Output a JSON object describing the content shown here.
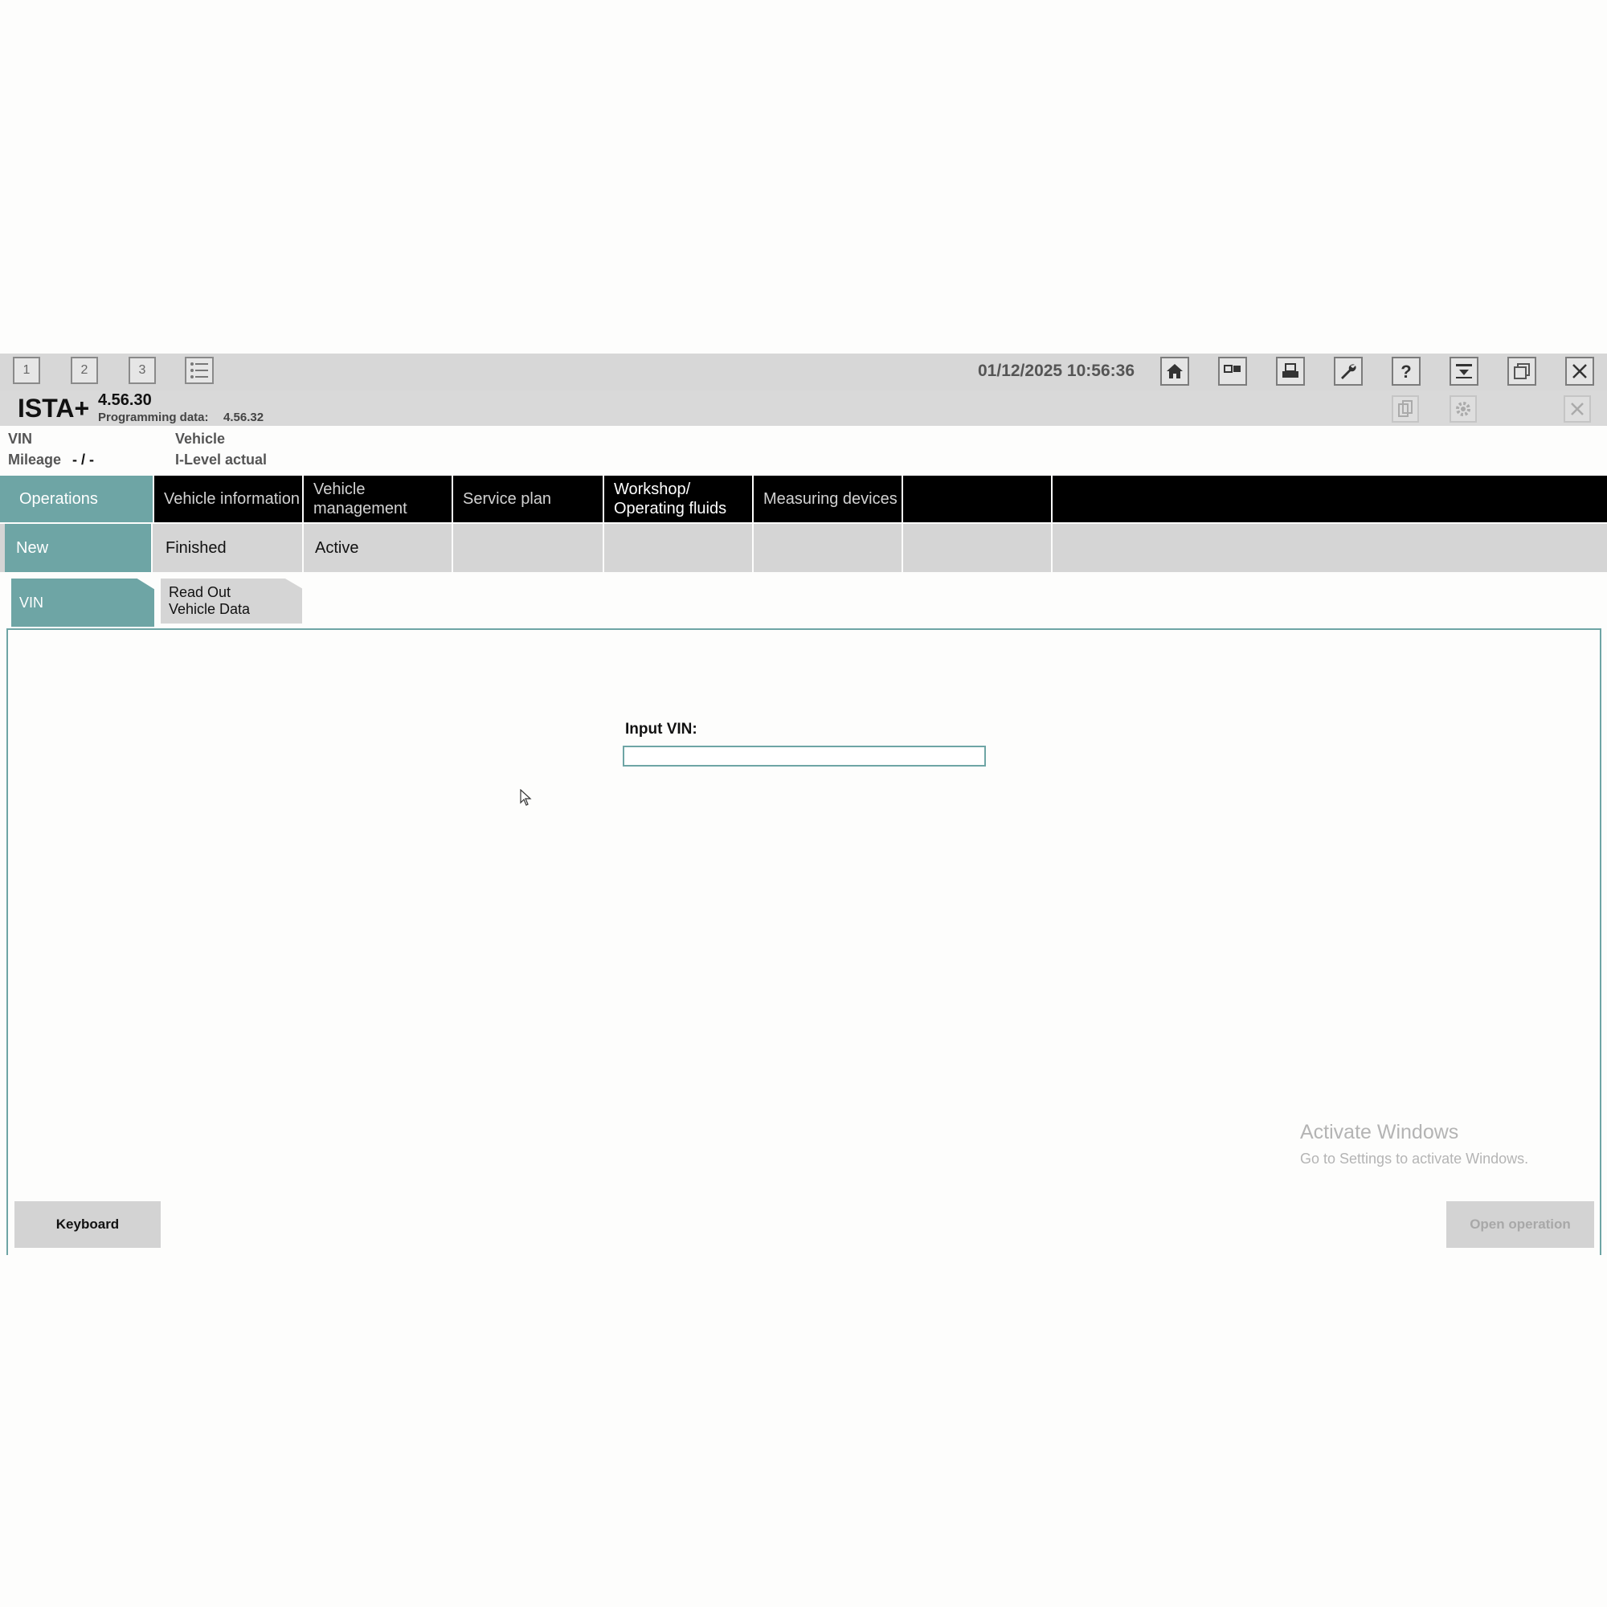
{
  "toolbar": {
    "screen_buttons": [
      "1",
      "2",
      "3"
    ],
    "datetime": "01/12/2025 10:56:36"
  },
  "header": {
    "app_name": "ISTA+",
    "version": "4.56.30",
    "programming_label": "Programming data:",
    "programming_value": "4.56.32"
  },
  "vehicle_info": {
    "vin_label": "VIN",
    "mileage_label": "Mileage",
    "mileage_value": "- / -",
    "vehicle_label": "Vehicle",
    "ilevel_label": "I-Level actual"
  },
  "main_nav": [
    {
      "label": "Operations"
    },
    {
      "label": "Vehicle information"
    },
    {
      "label": "Vehicle management"
    },
    {
      "label": "Service plan"
    },
    {
      "label": "Workshop/ Operating fluids"
    },
    {
      "label": "Measuring devices"
    }
  ],
  "sub_nav": [
    {
      "label": "New"
    },
    {
      "label": "Finished"
    },
    {
      "label": "Active"
    }
  ],
  "tertiary_tabs": [
    {
      "label": "VIN"
    },
    {
      "label": "Read Out Vehicle Data"
    }
  ],
  "form": {
    "vin_label": "Input VIN:",
    "vin_value": ""
  },
  "watermark": {
    "line1": "Activate Windows",
    "line2": "Go to Settings to activate Windows."
  },
  "buttons": {
    "keyboard": "Keyboard",
    "open_operation": "Open operation"
  },
  "colors": {
    "accent": "#6ea5a5",
    "nav_bg": "#000000",
    "toolbar_bg": "#d7d7d7"
  }
}
